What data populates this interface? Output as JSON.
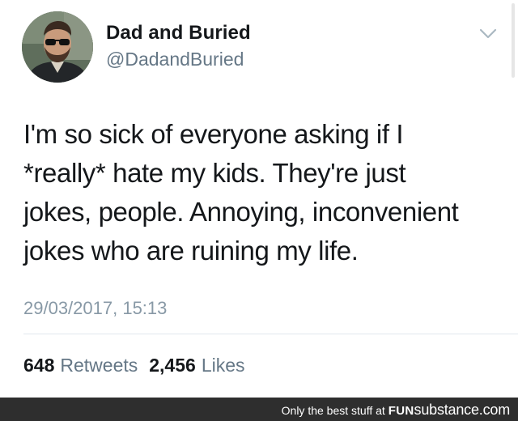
{
  "tweet": {
    "display_name": "Dad and Buried",
    "handle": "@DadandBuried",
    "text": "I'm so sick of everyone asking if I\n*really* hate my kids. They're just\njokes, people. Annoying, inconvenient\njokes who are ruining my life.",
    "timestamp": "29/03/2017, 15:13",
    "stats": {
      "retweets_count": "648",
      "retweets_label": "Retweets",
      "likes_count": "2,456",
      "likes_label": "Likes"
    },
    "menu_icon": "chevron-down-icon"
  },
  "watermark": {
    "tagline": "Only the best stuff at",
    "brand_bold": "FUN",
    "brand_rest": "substance.com"
  },
  "colors": {
    "primary_text": "#14171a",
    "secondary_text": "#657786",
    "timestamp_text": "#8899a6",
    "footer_background": "#2e2e2e"
  }
}
